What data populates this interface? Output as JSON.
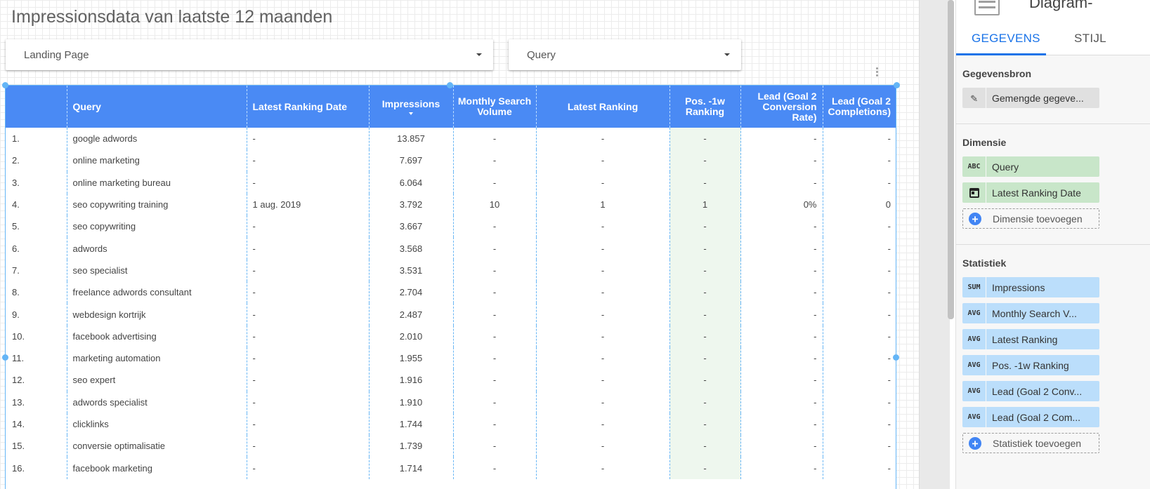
{
  "report": {
    "title": "Impressionsdata van laatste 12 maanden"
  },
  "filters": [
    {
      "label": "Landing Page"
    },
    {
      "label": "Query"
    }
  ],
  "table": {
    "headers": {
      "query": "Query",
      "date": "Latest Ranking Date",
      "impressions": "Impressions",
      "volume": "Monthly Search Volume",
      "ranking": "Latest Ranking",
      "pos": "Pos. -1w Ranking",
      "rate": "Lead (Goal 2 Conversion Rate)",
      "completions": "Lead (Goal 2 Completions)"
    },
    "rows": [
      {
        "idx": "1.",
        "query": "google adwords",
        "date": "-",
        "impressions": "13.857",
        "volume": "-",
        "ranking": "-",
        "pos": "-",
        "rate": "-",
        "completions": "-"
      },
      {
        "idx": "2.",
        "query": "online marketing",
        "date": "-",
        "impressions": "7.697",
        "volume": "-",
        "ranking": "-",
        "pos": "-",
        "rate": "-",
        "completions": "-"
      },
      {
        "idx": "3.",
        "query": "online marketing bureau",
        "date": "-",
        "impressions": "6.064",
        "volume": "-",
        "ranking": "-",
        "pos": "-",
        "rate": "-",
        "completions": "-"
      },
      {
        "idx": "4.",
        "query": "seo copywriting training",
        "date": "1 aug. 2019",
        "impressions": "3.792",
        "volume": "10",
        "ranking": "1",
        "pos": "1",
        "rate": "0%",
        "completions": "0"
      },
      {
        "idx": "5.",
        "query": "seo copywriting",
        "date": "-",
        "impressions": "3.667",
        "volume": "-",
        "ranking": "-",
        "pos": "-",
        "rate": "-",
        "completions": "-"
      },
      {
        "idx": "6.",
        "query": "adwords",
        "date": "-",
        "impressions": "3.568",
        "volume": "-",
        "ranking": "-",
        "pos": "-",
        "rate": "-",
        "completions": "-"
      },
      {
        "idx": "7.",
        "query": "seo specialist",
        "date": "-",
        "impressions": "3.531",
        "volume": "-",
        "ranking": "-",
        "pos": "-",
        "rate": "-",
        "completions": "-"
      },
      {
        "idx": "8.",
        "query": "freelance adwords consultant",
        "date": "-",
        "impressions": "2.704",
        "volume": "-",
        "ranking": "-",
        "pos": "-",
        "rate": "-",
        "completions": "-"
      },
      {
        "idx": "9.",
        "query": "webdesign kortrijk",
        "date": "-",
        "impressions": "2.487",
        "volume": "-",
        "ranking": "-",
        "pos": "-",
        "rate": "-",
        "completions": "-"
      },
      {
        "idx": "10.",
        "query": "facebook advertising",
        "date": "-",
        "impressions": "2.010",
        "volume": "-",
        "ranking": "-",
        "pos": "-",
        "rate": "-",
        "completions": "-"
      },
      {
        "idx": "11.",
        "query": "marketing automation",
        "date": "-",
        "impressions": "1.955",
        "volume": "-",
        "ranking": "-",
        "pos": "-",
        "rate": "-",
        "completions": "-"
      },
      {
        "idx": "12.",
        "query": "seo expert",
        "date": "-",
        "impressions": "1.916",
        "volume": "-",
        "ranking": "-",
        "pos": "-",
        "rate": "-",
        "completions": "-"
      },
      {
        "idx": "13.",
        "query": "adwords specialist",
        "date": "-",
        "impressions": "1.910",
        "volume": "-",
        "ranking": "-",
        "pos": "-",
        "rate": "-",
        "completions": "-"
      },
      {
        "idx": "14.",
        "query": "clicklinks",
        "date": "-",
        "impressions": "1.744",
        "volume": "-",
        "ranking": "-",
        "pos": "-",
        "rate": "-",
        "completions": "-"
      },
      {
        "idx": "15.",
        "query": "conversie optimalisatie",
        "date": "-",
        "impressions": "1.739",
        "volume": "-",
        "ranking": "-",
        "pos": "-",
        "rate": "-",
        "completions": "-"
      },
      {
        "idx": "16.",
        "query": "facebook marketing",
        "date": "-",
        "impressions": "1.714",
        "volume": "-",
        "ranking": "-",
        "pos": "-",
        "rate": "-",
        "completions": "-"
      }
    ]
  },
  "panel": {
    "chart_name": "Diagram-",
    "tabs": {
      "data": "GEGEVENS",
      "style": "STIJL"
    },
    "datasource": {
      "heading": "Gegevensbron",
      "name": "Gemengde gegeve..."
    },
    "dimensions": {
      "heading": "Dimensie",
      "items": [
        {
          "type": "ABC",
          "label": "Query"
        },
        {
          "type": "calendar-icon",
          "label": "Latest Ranking Date"
        }
      ],
      "add_label": "Dimensie toevoegen"
    },
    "metrics": {
      "heading": "Statistiek",
      "items": [
        {
          "type": "SUM",
          "label": "Impressions"
        },
        {
          "type": "AVG",
          "label": "Monthly Search V..."
        },
        {
          "type": "AVG",
          "label": "Latest Ranking"
        },
        {
          "type": "AVG",
          "label": "Pos. -1w Ranking"
        },
        {
          "type": "AVG",
          "label": "Lead (Goal 2 Conv..."
        },
        {
          "type": "AVG",
          "label": "Lead (Goal 2 Com..."
        }
      ],
      "add_label": "Statistiek toevoegen"
    }
  },
  "colors": {
    "header_blue": "#4a8af4",
    "selection": "#64b5f6",
    "dimension_chip": "#c8e6c9",
    "metric_chip": "#bbdefb",
    "tab_active": "#1a73e8"
  }
}
